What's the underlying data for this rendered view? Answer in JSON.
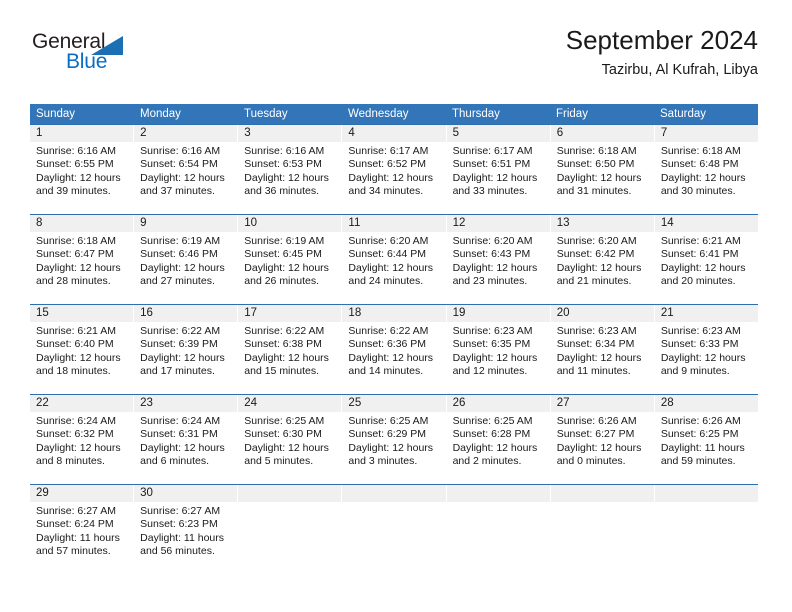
{
  "brand": {
    "name_part1": "General",
    "name_part2": "Blue",
    "triangle_color": "#1b6fb5",
    "blue_text_color": "#0a6ec4"
  },
  "header": {
    "title": "September 2024",
    "subtitle": "Tazirbu, Al Kufrah, Libya"
  },
  "theme": {
    "header_blue": "#3275b8",
    "daynum_band": "#f0f0f0",
    "row_separator": "#2f6fae"
  },
  "calendar": {
    "weekdays": [
      "Sunday",
      "Monday",
      "Tuesday",
      "Wednesday",
      "Thursday",
      "Friday",
      "Saturday"
    ],
    "weeks": [
      [
        {
          "day": "1",
          "sunrise": "Sunrise: 6:16 AM",
          "sunset": "Sunset: 6:55 PM",
          "daylight1": "Daylight: 12 hours",
          "daylight2": "and 39 minutes."
        },
        {
          "day": "2",
          "sunrise": "Sunrise: 6:16 AM",
          "sunset": "Sunset: 6:54 PM",
          "daylight1": "Daylight: 12 hours",
          "daylight2": "and 37 minutes."
        },
        {
          "day": "3",
          "sunrise": "Sunrise: 6:16 AM",
          "sunset": "Sunset: 6:53 PM",
          "daylight1": "Daylight: 12 hours",
          "daylight2": "and 36 minutes."
        },
        {
          "day": "4",
          "sunrise": "Sunrise: 6:17 AM",
          "sunset": "Sunset: 6:52 PM",
          "daylight1": "Daylight: 12 hours",
          "daylight2": "and 34 minutes."
        },
        {
          "day": "5",
          "sunrise": "Sunrise: 6:17 AM",
          "sunset": "Sunset: 6:51 PM",
          "daylight1": "Daylight: 12 hours",
          "daylight2": "and 33 minutes."
        },
        {
          "day": "6",
          "sunrise": "Sunrise: 6:18 AM",
          "sunset": "Sunset: 6:50 PM",
          "daylight1": "Daylight: 12 hours",
          "daylight2": "and 31 minutes."
        },
        {
          "day": "7",
          "sunrise": "Sunrise: 6:18 AM",
          "sunset": "Sunset: 6:48 PM",
          "daylight1": "Daylight: 12 hours",
          "daylight2": "and 30 minutes."
        }
      ],
      [
        {
          "day": "8",
          "sunrise": "Sunrise: 6:18 AM",
          "sunset": "Sunset: 6:47 PM",
          "daylight1": "Daylight: 12 hours",
          "daylight2": "and 28 minutes."
        },
        {
          "day": "9",
          "sunrise": "Sunrise: 6:19 AM",
          "sunset": "Sunset: 6:46 PM",
          "daylight1": "Daylight: 12 hours",
          "daylight2": "and 27 minutes."
        },
        {
          "day": "10",
          "sunrise": "Sunrise: 6:19 AM",
          "sunset": "Sunset: 6:45 PM",
          "daylight1": "Daylight: 12 hours",
          "daylight2": "and 26 minutes."
        },
        {
          "day": "11",
          "sunrise": "Sunrise: 6:20 AM",
          "sunset": "Sunset: 6:44 PM",
          "daylight1": "Daylight: 12 hours",
          "daylight2": "and 24 minutes."
        },
        {
          "day": "12",
          "sunrise": "Sunrise: 6:20 AM",
          "sunset": "Sunset: 6:43 PM",
          "daylight1": "Daylight: 12 hours",
          "daylight2": "and 23 minutes."
        },
        {
          "day": "13",
          "sunrise": "Sunrise: 6:20 AM",
          "sunset": "Sunset: 6:42 PM",
          "daylight1": "Daylight: 12 hours",
          "daylight2": "and 21 minutes."
        },
        {
          "day": "14",
          "sunrise": "Sunrise: 6:21 AM",
          "sunset": "Sunset: 6:41 PM",
          "daylight1": "Daylight: 12 hours",
          "daylight2": "and 20 minutes."
        }
      ],
      [
        {
          "day": "15",
          "sunrise": "Sunrise: 6:21 AM",
          "sunset": "Sunset: 6:40 PM",
          "daylight1": "Daylight: 12 hours",
          "daylight2": "and 18 minutes."
        },
        {
          "day": "16",
          "sunrise": "Sunrise: 6:22 AM",
          "sunset": "Sunset: 6:39 PM",
          "daylight1": "Daylight: 12 hours",
          "daylight2": "and 17 minutes."
        },
        {
          "day": "17",
          "sunrise": "Sunrise: 6:22 AM",
          "sunset": "Sunset: 6:38 PM",
          "daylight1": "Daylight: 12 hours",
          "daylight2": "and 15 minutes."
        },
        {
          "day": "18",
          "sunrise": "Sunrise: 6:22 AM",
          "sunset": "Sunset: 6:36 PM",
          "daylight1": "Daylight: 12 hours",
          "daylight2": "and 14 minutes."
        },
        {
          "day": "19",
          "sunrise": "Sunrise: 6:23 AM",
          "sunset": "Sunset: 6:35 PM",
          "daylight1": "Daylight: 12 hours",
          "daylight2": "and 12 minutes."
        },
        {
          "day": "20",
          "sunrise": "Sunrise: 6:23 AM",
          "sunset": "Sunset: 6:34 PM",
          "daylight1": "Daylight: 12 hours",
          "daylight2": "and 11 minutes."
        },
        {
          "day": "21",
          "sunrise": "Sunrise: 6:23 AM",
          "sunset": "Sunset: 6:33 PM",
          "daylight1": "Daylight: 12 hours",
          "daylight2": "and 9 minutes."
        }
      ],
      [
        {
          "day": "22",
          "sunrise": "Sunrise: 6:24 AM",
          "sunset": "Sunset: 6:32 PM",
          "daylight1": "Daylight: 12 hours",
          "daylight2": "and 8 minutes."
        },
        {
          "day": "23",
          "sunrise": "Sunrise: 6:24 AM",
          "sunset": "Sunset: 6:31 PM",
          "daylight1": "Daylight: 12 hours",
          "daylight2": "and 6 minutes."
        },
        {
          "day": "24",
          "sunrise": "Sunrise: 6:25 AM",
          "sunset": "Sunset: 6:30 PM",
          "daylight1": "Daylight: 12 hours",
          "daylight2": "and 5 minutes."
        },
        {
          "day": "25",
          "sunrise": "Sunrise: 6:25 AM",
          "sunset": "Sunset: 6:29 PM",
          "daylight1": "Daylight: 12 hours",
          "daylight2": "and 3 minutes."
        },
        {
          "day": "26",
          "sunrise": "Sunrise: 6:25 AM",
          "sunset": "Sunset: 6:28 PM",
          "daylight1": "Daylight: 12 hours",
          "daylight2": "and 2 minutes."
        },
        {
          "day": "27",
          "sunrise": "Sunrise: 6:26 AM",
          "sunset": "Sunset: 6:27 PM",
          "daylight1": "Daylight: 12 hours",
          "daylight2": "and 0 minutes."
        },
        {
          "day": "28",
          "sunrise": "Sunrise: 6:26 AM",
          "sunset": "Sunset: 6:25 PM",
          "daylight1": "Daylight: 11 hours",
          "daylight2": "and 59 minutes."
        }
      ],
      [
        {
          "day": "29",
          "sunrise": "Sunrise: 6:27 AM",
          "sunset": "Sunset: 6:24 PM",
          "daylight1": "Daylight: 11 hours",
          "daylight2": "and 57 minutes."
        },
        {
          "day": "30",
          "sunrise": "Sunrise: 6:27 AM",
          "sunset": "Sunset: 6:23 PM",
          "daylight1": "Daylight: 11 hours",
          "daylight2": "and 56 minutes."
        },
        {
          "day": "",
          "sunrise": "",
          "sunset": "",
          "daylight1": "",
          "daylight2": ""
        },
        {
          "day": "",
          "sunrise": "",
          "sunset": "",
          "daylight1": "",
          "daylight2": ""
        },
        {
          "day": "",
          "sunrise": "",
          "sunset": "",
          "daylight1": "",
          "daylight2": ""
        },
        {
          "day": "",
          "sunrise": "",
          "sunset": "",
          "daylight1": "",
          "daylight2": ""
        },
        {
          "day": "",
          "sunrise": "",
          "sunset": "",
          "daylight1": "",
          "daylight2": ""
        }
      ]
    ]
  }
}
